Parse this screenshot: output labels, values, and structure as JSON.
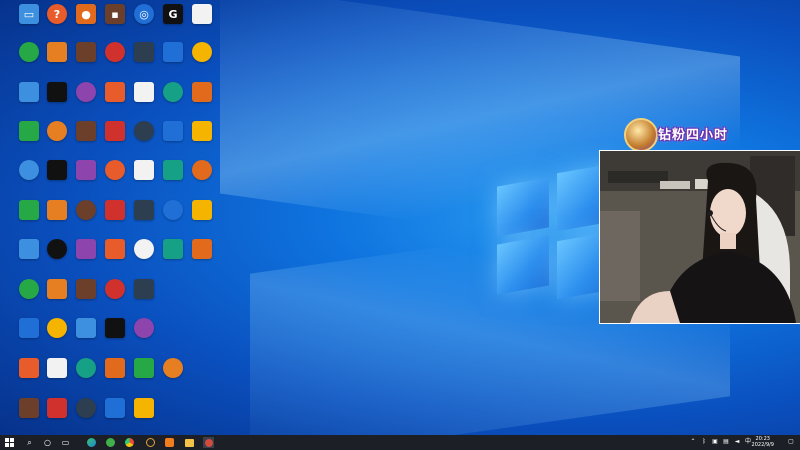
{
  "overlay": {
    "badge_text": "钻粉四小时"
  },
  "taskbar": {
    "date": "2022/9/9",
    "time": "20:23"
  },
  "desktop_icons": [
    {
      "name": "this-pc",
      "color": "#3d8fe0",
      "symbol": "▭"
    },
    {
      "name": "pinned-app-1",
      "color": "#e85b2a",
      "symbol": "?"
    },
    {
      "name": "pinned-app-2",
      "color": "#e26a1c",
      "symbol": "●"
    },
    {
      "name": "pinned-app-3",
      "color": "#6c3f2a",
      "symbol": "▪"
    },
    {
      "name": "wallpaper-engine",
      "color": "#1f6fd6",
      "symbol": "◎"
    },
    {
      "name": "logitech",
      "color": "#111111",
      "symbol": "G"
    },
    {
      "name": "document",
      "color": "#f2f2f2",
      "symbol": ""
    }
  ]
}
